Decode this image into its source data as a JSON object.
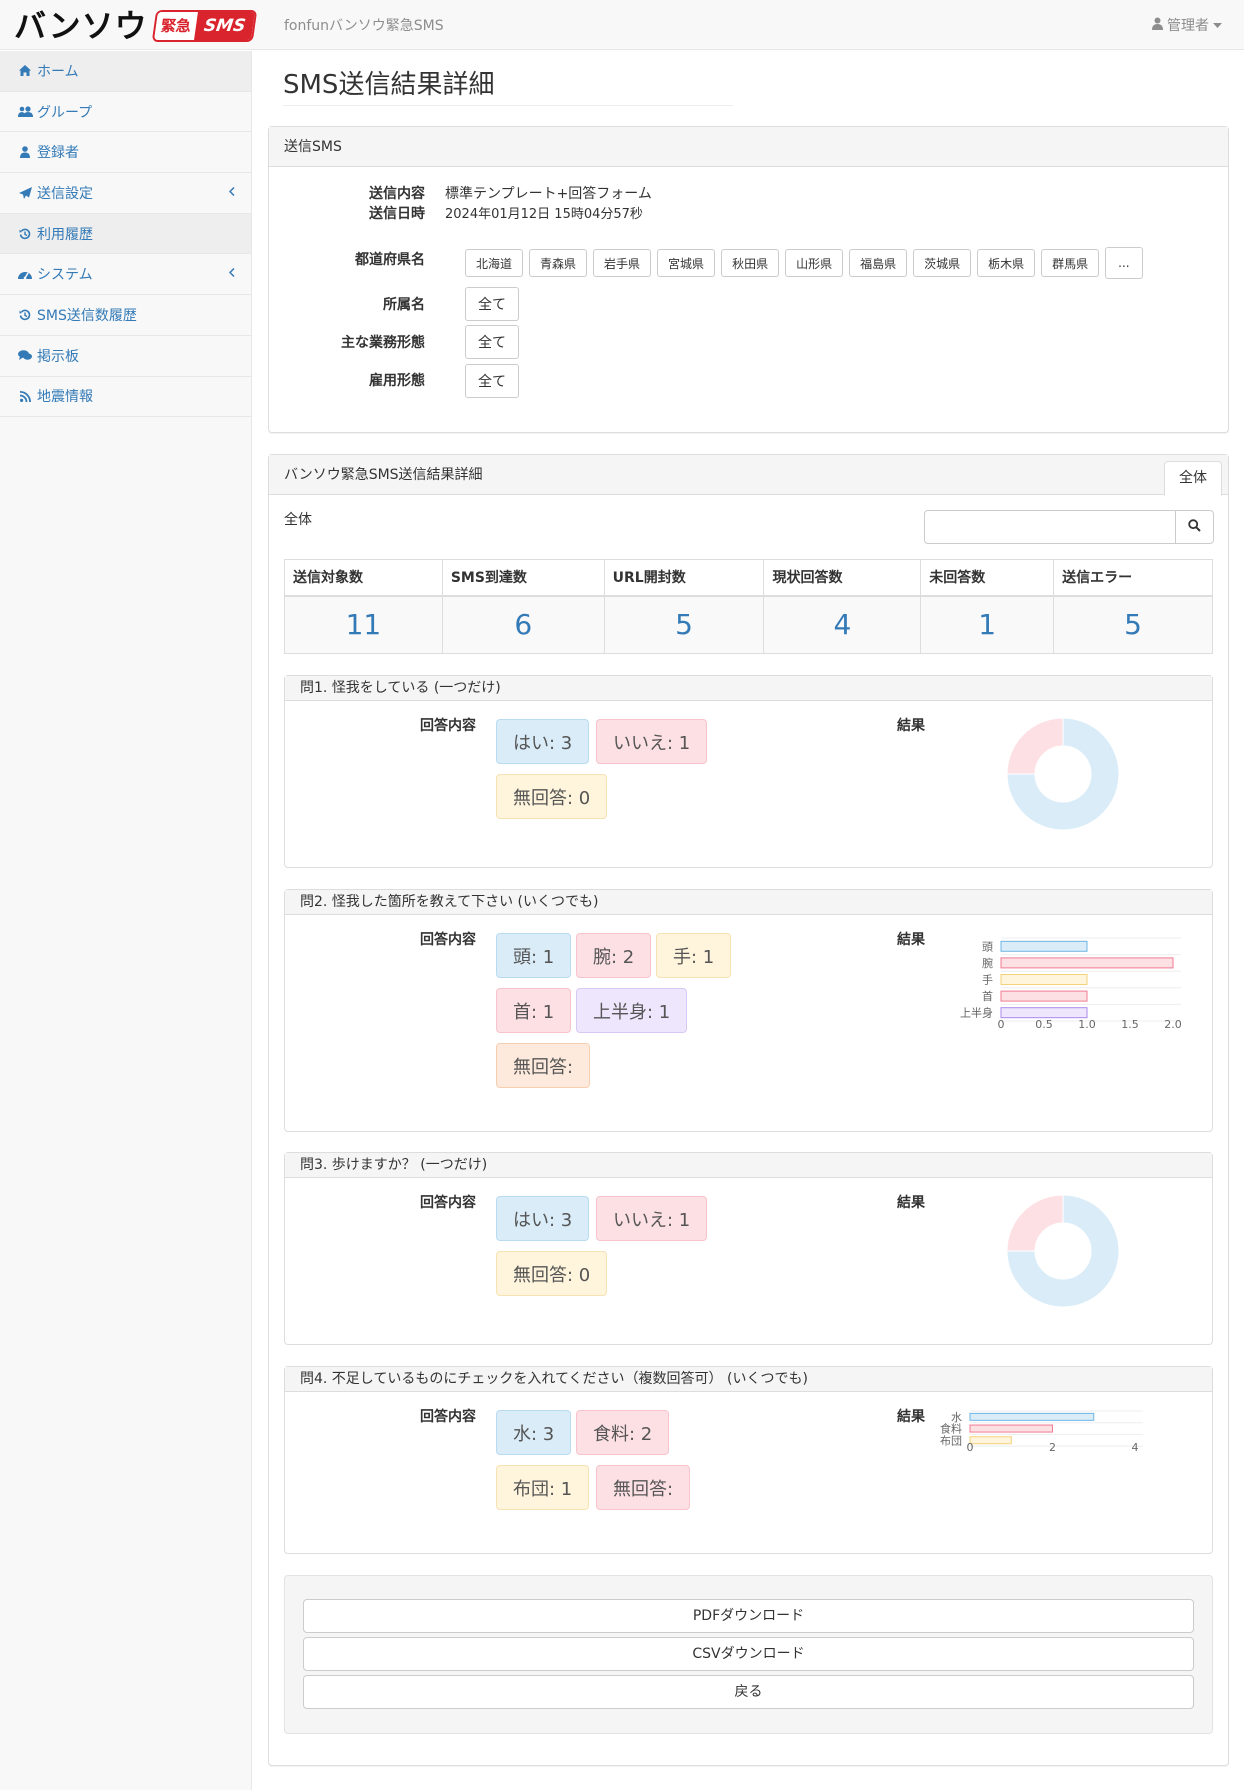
{
  "header": {
    "logo_main": "バンソウ",
    "logo_badge_kanji": "緊急",
    "logo_badge_sms": "SMS",
    "brand": "fonfunバンソウ緊急SMS",
    "user": "管理者"
  },
  "sidebar": {
    "items": [
      {
        "label": "ホーム",
        "icon": "home-icon"
      },
      {
        "label": "グループ",
        "icon": "users-icon"
      },
      {
        "label": "登録者",
        "icon": "user-icon"
      },
      {
        "label": "送信設定",
        "icon": "paper-plane-icon"
      },
      {
        "label": "利用履歴",
        "icon": "history-icon"
      },
      {
        "label": "システム",
        "icon": "dashboard-icon"
      },
      {
        "label": "SMS送信数履歴",
        "icon": "history-icon"
      },
      {
        "label": "掲示板",
        "icon": "comments-icon"
      },
      {
        "label": "地震情報",
        "icon": "rss-icon"
      }
    ]
  },
  "page": {
    "title": "SMS送信結果詳細"
  },
  "send_panel": {
    "heading": "送信SMS",
    "content_label": "送信内容",
    "content_value": "標準テンプレート+回答フォーム",
    "datetime_label": "送信日時",
    "datetime_value": "2024年01月12日 15時04分57秒",
    "prefecture_label": "都道府県名",
    "prefectures": [
      "北海道",
      "青森県",
      "岩手県",
      "宮城県",
      "秋田県",
      "山形県",
      "福島県",
      "茨城県",
      "栃木県",
      "群馬県"
    ],
    "more_label": "...",
    "affiliation_label": "所属名",
    "affiliation_value": "全て",
    "business_label": "主な業務形態",
    "business_value": "全て",
    "employment_label": "雇用形態",
    "employment_value": "全て"
  },
  "result_panel": {
    "heading": "バンソウ緊急SMS送信結果詳細",
    "tab": "全体",
    "scope_label": "全体",
    "search_placeholder": "",
    "stats": [
      {
        "label": "送信対象数",
        "value": "11"
      },
      {
        "label": "SMS到達数",
        "value": "6"
      },
      {
        "label": "URL開封数",
        "value": "5"
      },
      {
        "label": "現状回答数",
        "value": "4"
      },
      {
        "label": "未回答数",
        "value": "1"
      },
      {
        "label": "送信エラー",
        "value": "5"
      }
    ]
  },
  "questions": {
    "answer_label": "回答内容",
    "result_label": "結果",
    "q1": {
      "title": "問1. 怪我をしている (一つだけ)",
      "answers": [
        "はい: 3",
        "いいえ: 1",
        "無回答: 0"
      ]
    },
    "q2": {
      "title": "問2. 怪我した箇所を教えて下さい (いくつでも)",
      "answers": [
        "頭: 1",
        "腕: 2",
        "手: 1",
        "首: 1",
        "上半身: 1",
        "無回答:"
      ]
    },
    "q3": {
      "title": "問3. 歩けますか？ (一つだけ)",
      "answers": [
        "はい: 3",
        "いいえ: 1",
        "無回答: 0"
      ]
    },
    "q4": {
      "title": "問4. 不足しているものにチェックを入れてください（複数回答可） (いくつでも)",
      "answers": [
        "水: 3",
        "食料: 2",
        "布団: 1",
        "無回答:"
      ]
    }
  },
  "chart_data": [
    {
      "type": "pie",
      "categories": [
        "はい",
        "いいえ"
      ],
      "values": [
        3,
        1
      ],
      "colors": [
        "#d9ecf8",
        "#fde0e4"
      ]
    },
    {
      "type": "bar",
      "orientation": "horizontal",
      "categories": [
        "頭",
        "腕",
        "手",
        "首",
        "上半身"
      ],
      "values": [
        1,
        2,
        1,
        1,
        1
      ],
      "xlim": [
        0,
        2
      ],
      "xticks": [
        "0",
        "0.5",
        "1.0",
        "1.5",
        "2.0"
      ],
      "fills": [
        "#d9ecf8",
        "#fde0e4",
        "#fff4dc",
        "#fde0e4",
        "#eee6fc"
      ],
      "strokes": [
        "#6fb6e6",
        "#f07b92",
        "#f3d27a",
        "#f07b92",
        "#a98aed"
      ]
    },
    {
      "type": "pie",
      "categories": [
        "はい",
        "いいえ"
      ],
      "values": [
        3,
        1
      ],
      "colors": [
        "#d9ecf8",
        "#fde0e4"
      ]
    },
    {
      "type": "bar",
      "orientation": "horizontal",
      "categories": [
        "水",
        "食料",
        "布団"
      ],
      "values": [
        3,
        2,
        1
      ],
      "xlim": [
        0,
        4
      ],
      "xticks": [
        "0",
        "2",
        "4"
      ],
      "fills": [
        "#d9ecf8",
        "#fde0e4",
        "#fff4dc"
      ],
      "strokes": [
        "#6fb6e6",
        "#f07b92",
        "#f3d27a"
      ]
    }
  ],
  "actions": {
    "pdf": "PDFダウンロード",
    "csv": "CSVダウンロード",
    "back": "戻る"
  }
}
